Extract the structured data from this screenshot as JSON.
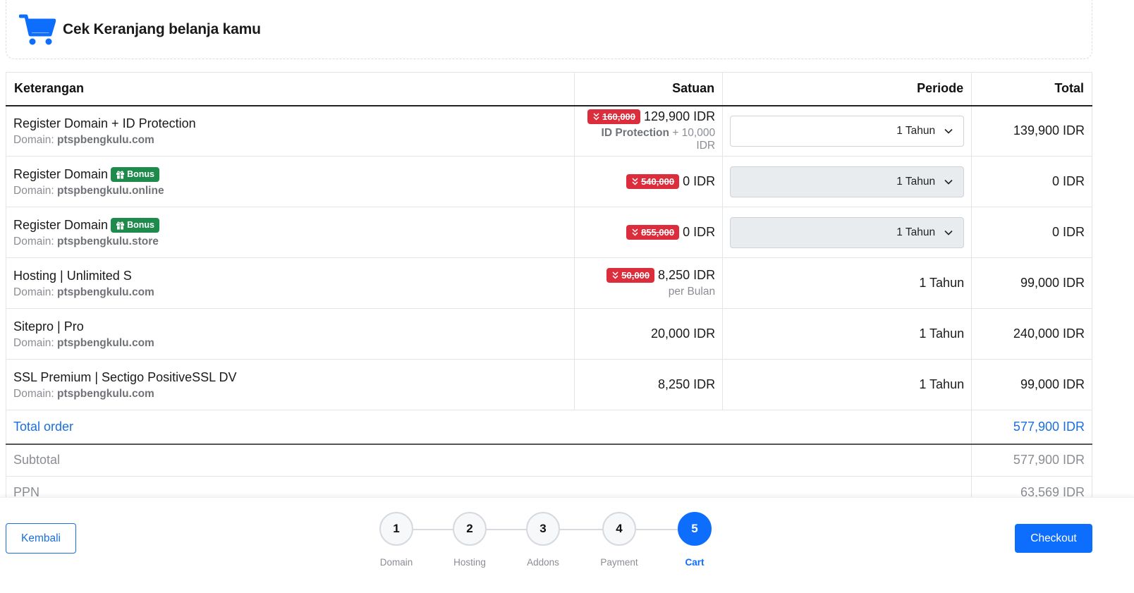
{
  "header": {
    "title": "Cek Keranjang belanja kamu",
    "icon": "shopping-cart-icon",
    "accent": "#0d6efd"
  },
  "table": {
    "columns": {
      "description": "Keterangan",
      "unit": "Satuan",
      "period": "Periode",
      "total": "Total"
    },
    "domain_prefix": "Domain:",
    "rows": [
      {
        "name": "Register Domain + ID Protection",
        "bonus": "",
        "domain": "ptspbengkulu.com",
        "old_price": "160,000",
        "price": "129,900 IDR",
        "sub_bold": "ID Protection",
        "sub_text": "+ 10,000 IDR",
        "period": "1 Tahun",
        "total": "139,900 IDR"
      },
      {
        "name": "Register Domain",
        "bonus": "Bonus",
        "domain": "ptspbengkulu.online",
        "old_price": "540,000",
        "price": "0 IDR",
        "period": "1 Tahun",
        "total": "0 IDR"
      },
      {
        "name": "Register Domain",
        "bonus": "Bonus",
        "domain": "ptspbengkulu.store",
        "old_price": "855,000",
        "price": "0 IDR",
        "period": "1 Tahun",
        "total": "0 IDR"
      },
      {
        "name": "Hosting | Unlimited S",
        "domain": "ptspbengkulu.com",
        "old_price": "50,000",
        "price": "8,250 IDR",
        "sub_text": "per Bulan",
        "period": "1 Tahun",
        "total": "99,000 IDR"
      },
      {
        "name": "Sitepro | Pro",
        "domain": "ptspbengkulu.com",
        "price": "20,000 IDR",
        "period": "1 Tahun",
        "total": "240,000 IDR"
      },
      {
        "name": "SSL Premium | Sectigo PositiveSSL DV",
        "domain": "ptspbengkulu.com",
        "price": "8,250 IDR",
        "period": "1 Tahun",
        "total": "99,000 IDR"
      }
    ],
    "total_order": {
      "label": "Total order",
      "value": "577,900 IDR"
    },
    "subtotal": {
      "label": "Subtotal",
      "value": "577,900 IDR"
    },
    "ppn": {
      "label": "PPN",
      "value": "63,569 IDR"
    }
  },
  "footer": {
    "back_label": "Kembali",
    "checkout_label": "Checkout",
    "steps": [
      {
        "number": "1",
        "label": "Domain"
      },
      {
        "number": "2",
        "label": "Hosting"
      },
      {
        "number": "3",
        "label": "Addons"
      },
      {
        "number": "4",
        "label": "Payment"
      },
      {
        "number": "5",
        "label": "Cart"
      }
    ],
    "active_step": "5"
  }
}
